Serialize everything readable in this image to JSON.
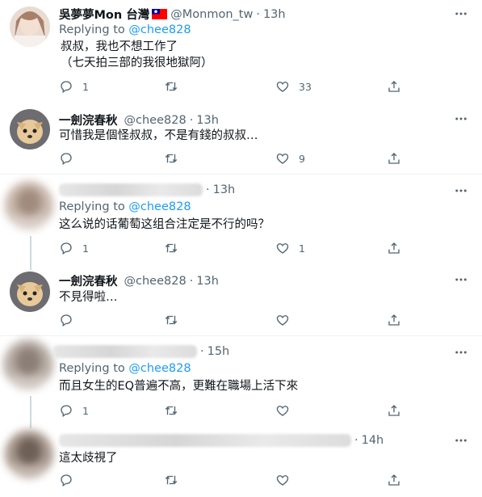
{
  "tweets": [
    {
      "name": "吳夢夢Mon 台灣",
      "handle": "@Monmon_tw",
      "time": "13h",
      "replying_to_prefix": "",
      "replying_to": "",
      "text": "叔叔，我也不想工作了\n（七天拍三部的我很地獄阿）",
      "reply_count": "1",
      "retweet_count": "",
      "like_count": "33",
      "flag_icon": "taiwan-flag-icon"
    },
    {
      "name": "一劍浣春秋",
      "handle": "@chee828",
      "time": "13h",
      "replying_to_prefix": "",
      "replying_to": "",
      "text": "可惜我是個怪叔叔，不是有錢的叔叔…",
      "reply_count": "",
      "retweet_count": "",
      "like_count": "9"
    },
    {
      "name": "",
      "handle": "",
      "time": "13h",
      "replying_to_prefix": "Replying to",
      "replying_to": "@chee828",
      "text": "这么说的话葡萄这组合注定是不行的吗？",
      "reply_count": "1",
      "retweet_count": "",
      "like_count": "1"
    },
    {
      "name": "一劍浣春秋",
      "handle": "@chee828",
      "time": "13h",
      "replying_to_prefix": "",
      "replying_to": "",
      "text": "不見得啦…",
      "reply_count": "",
      "retweet_count": "",
      "like_count": ""
    },
    {
      "name": "",
      "handle": "",
      "time": "15h",
      "replying_to_prefix": "Replying to",
      "replying_to": "@chee828",
      "text": "而且女生的EQ普遍不高，更難在職場上活下來",
      "reply_count": "1",
      "retweet_count": "",
      "like_count": ""
    },
    {
      "name": "",
      "handle": "",
      "time": "14h",
      "replying_to_prefix": "",
      "replying_to": "",
      "text": "這太歧視了",
      "reply_count": "",
      "retweet_count": "",
      "like_count": ""
    }
  ],
  "colors": {
    "accent": "#1d9bf0",
    "secondary_text": "#536471",
    "primary_text": "#0f1419",
    "divider": "#eff3f4"
  },
  "icons": [
    "reply-icon",
    "retweet-icon",
    "like-icon",
    "share-icon",
    "more-icon"
  ]
}
